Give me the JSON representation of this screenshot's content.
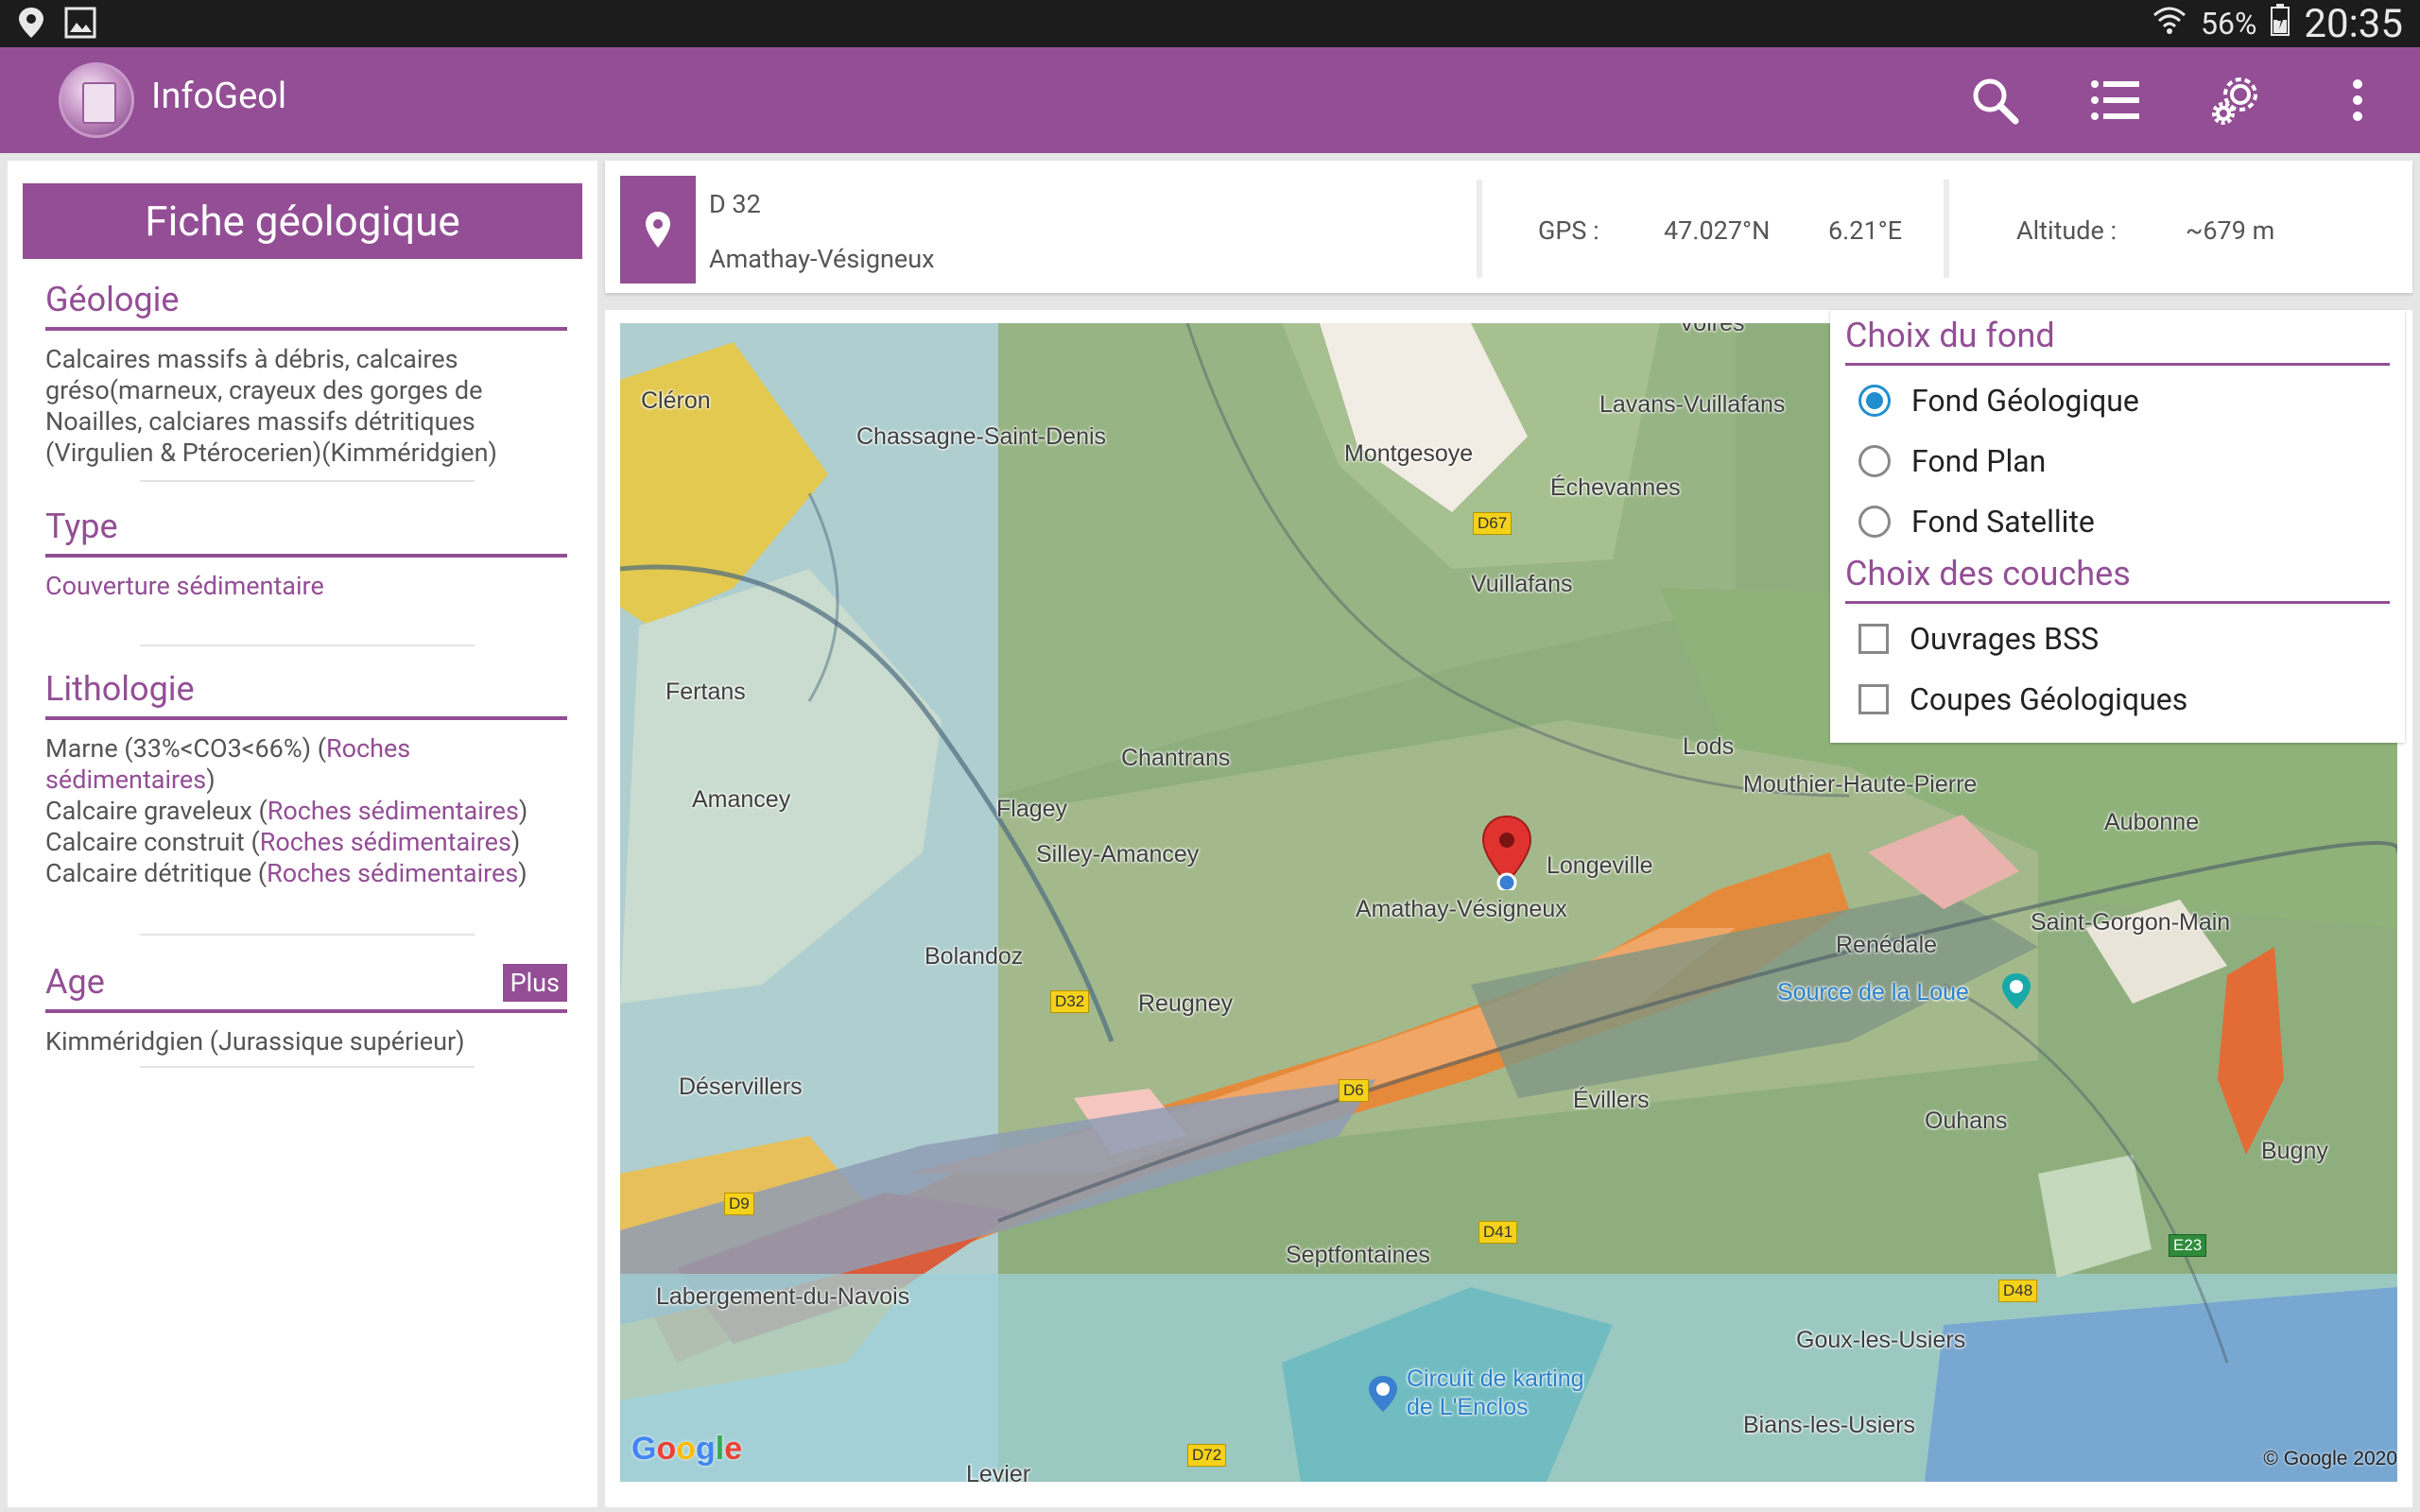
{
  "status_bar": {
    "battery": "56%",
    "time": "20:35",
    "left_icons": [
      "location-icon",
      "image-icon"
    ],
    "right_icons": [
      "wifi-icon",
      "battery-icon"
    ]
  },
  "app_bar": {
    "title": "InfoGeol",
    "actions": [
      "search-icon",
      "list-icon",
      "settings-icon",
      "overflow-menu-icon"
    ]
  },
  "fiche": {
    "header": "Fiche géologique",
    "geologie": {
      "title": "Géologie",
      "text": "Calcaires massifs à débris, calcaires gréso(marneux, crayeux des gorges de Noailles, calciares massifs détritiques (Virgulien & Ptérocerien)(Kimméridgien)"
    },
    "type": {
      "title": "Type",
      "text": "Couverture sédimentaire"
    },
    "lithologie": {
      "title": "Lithologie",
      "items": [
        {
          "name": "Marne (33%<CO3<66%) (",
          "link": "Roches sédimentaires",
          "end": ")"
        },
        {
          "name": "Calcaire graveleux (",
          "link": "Roches sédimentaires",
          "end": ")"
        },
        {
          "name": "Calcaire construit (",
          "link": "Roches sédimentaires",
          "end": ")"
        },
        {
          "name": "Calcaire détritique (",
          "link": "Roches sédimentaires",
          "end": ")"
        }
      ]
    },
    "age": {
      "title": "Age",
      "more_label": "Plus",
      "text": "Kimméridgien (Jurassique supérieur)"
    }
  },
  "location": {
    "road": "D 32",
    "commune": "Amathay-Vésigneux",
    "gps_label": "GPS :",
    "lat": "47.027°N",
    "lon": "6.21°E",
    "altitude_label": "Altitude :",
    "altitude": "~679 m"
  },
  "map": {
    "labels": {
      "cleron": "Cléron",
      "chassagne": "Chassagne-Saint-Denis",
      "montgesoye": "Montgesoye",
      "lavans": "Lavans-Vuillafans",
      "echevannes": "Échevannes",
      "vuillafans": "Vuillafans",
      "fertans": "Fertans",
      "chantrans": "Chantrans",
      "lods": "Lods",
      "mouthier": "Mouthier-Haute-Pierre",
      "amancey": "Amancey",
      "flagey": "Flagey",
      "silley": "Silley-Amancey",
      "longeville": "Longeville",
      "aubonne": "Aubonne",
      "amathay": "Amathay-Vésigneux",
      "bolandoz": "Bolandoz",
      "reugney": "Reugney",
      "renedale": "Renédale",
      "saintgorgon": "Saint-Gorgon-Main",
      "source": "Source de la Loue",
      "deservillers": "Déservillers",
      "evillers": "Évillers",
      "ouhans": "Ouhans",
      "bugny": "Bugny",
      "septfontaines": "Septfontaines",
      "labergement": "Labergement-du-Navois",
      "goux": "Goux-les-Usiers",
      "circuit": "Circuit de karting\nde L'Enclos",
      "bians": "Bians-les-Usiers",
      "voires": "Voires",
      "levier": "Levier"
    },
    "roads": {
      "d67": "D67",
      "d32": "D32",
      "d6": "D6",
      "d9": "D9",
      "d41": "D41",
      "d48": "D48",
      "e23": "E23",
      "d72": "D72"
    },
    "logo": "Google",
    "copyright": "© Google 2020"
  },
  "overlay": {
    "fond_title": "Choix du fond",
    "fond_options": [
      {
        "label": "Fond Géologique",
        "selected": true
      },
      {
        "label": "Fond Plan",
        "selected": false
      },
      {
        "label": "Fond Satellite",
        "selected": false
      }
    ],
    "couches_title": "Choix des couches",
    "couches_options": [
      {
        "label": "Ouvrages BSS",
        "checked": false
      },
      {
        "label": "Coupes Géologiques",
        "checked": false
      }
    ]
  },
  "colors": {
    "primary": "#934e95",
    "radio_active": "#1f8fcf",
    "status_bar": "#1c1c1c"
  }
}
